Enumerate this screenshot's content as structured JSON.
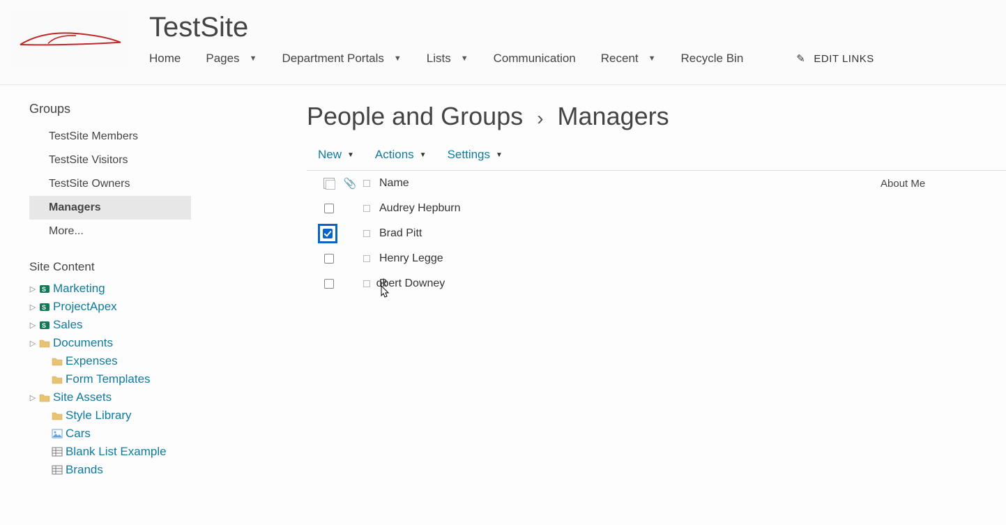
{
  "header": {
    "site_title": "TestSite",
    "nav": [
      {
        "label": "Home",
        "has_dropdown": false
      },
      {
        "label": "Pages",
        "has_dropdown": true
      },
      {
        "label": "Department Portals",
        "has_dropdown": true
      },
      {
        "label": "Lists",
        "has_dropdown": true
      },
      {
        "label": "Communication",
        "has_dropdown": false
      },
      {
        "label": "Recent",
        "has_dropdown": true
      },
      {
        "label": "Recycle Bin",
        "has_dropdown": false
      }
    ],
    "edit_links_label": "EDIT LINKS"
  },
  "left_nav": {
    "groups_heading": "Groups",
    "groups": [
      {
        "label": "TestSite Members",
        "selected": false
      },
      {
        "label": "TestSite Visitors",
        "selected": false
      },
      {
        "label": "TestSite Owners",
        "selected": false
      },
      {
        "label": "Managers",
        "selected": true
      },
      {
        "label": "More...",
        "selected": false
      }
    ],
    "site_content_heading": "Site Content",
    "tree": [
      {
        "label": "Marketing",
        "icon": "sp-site",
        "expandable": true,
        "indent": 0
      },
      {
        "label": "ProjectApex",
        "icon": "sp-site",
        "expandable": true,
        "indent": 0
      },
      {
        "label": "Sales",
        "icon": "sp-site",
        "expandable": true,
        "indent": 0
      },
      {
        "label": "Documents",
        "icon": "folder",
        "expandable": true,
        "indent": 0
      },
      {
        "label": "Expenses",
        "icon": "folder",
        "expandable": false,
        "indent": 1
      },
      {
        "label": "Form Templates",
        "icon": "folder",
        "expandable": false,
        "indent": 1
      },
      {
        "label": "Site Assets",
        "icon": "folder",
        "expandable": true,
        "indent": 0
      },
      {
        "label": "Style Library",
        "icon": "folder",
        "expandable": false,
        "indent": 1
      },
      {
        "label": "Cars",
        "icon": "piclib",
        "expandable": false,
        "indent": 1
      },
      {
        "label": "Blank List Example",
        "icon": "list",
        "expandable": false,
        "indent": 1
      },
      {
        "label": "Brands",
        "icon": "list",
        "expandable": false,
        "indent": 1
      }
    ]
  },
  "content": {
    "breadcrumb_root": "People and Groups",
    "breadcrumb_current": "Managers",
    "toolbar": {
      "new_label": "New",
      "actions_label": "Actions",
      "settings_label": "Settings"
    },
    "columns": {
      "name_header": "Name",
      "about_header": "About Me"
    },
    "rows": [
      {
        "name": "Audrey Hepburn",
        "checked": false
      },
      {
        "name": "Brad Pitt",
        "checked": true
      },
      {
        "name": "Henry Legge",
        "checked": false
      },
      {
        "name": "Robert Downey",
        "checked": false
      }
    ]
  }
}
